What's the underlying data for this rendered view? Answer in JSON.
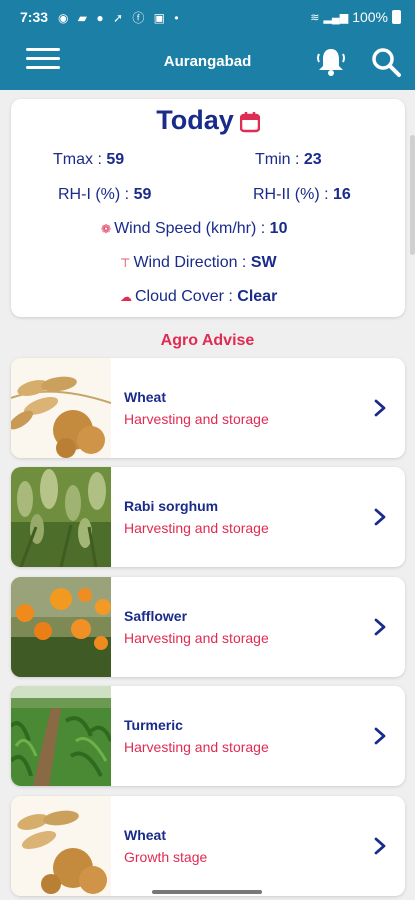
{
  "status_bar": {
    "time": "7:33",
    "battery": "100%"
  },
  "app_bar": {
    "title": "Aurangabad"
  },
  "weather": {
    "title": "Today",
    "tmax_label": "Tmax :",
    "tmax_value": "59",
    "tmin_label": "Tmin :",
    "tmin_value": "23",
    "rh1_label": "RH-I (%) :",
    "rh1_value": "59",
    "rh2_label": "RH-II (%) :",
    "rh2_value": "16",
    "wind_speed_label": "Wind Speed (km/hr) :",
    "wind_speed_value": "10",
    "wind_direction_label": "Wind Direction :",
    "wind_direction_value": "SW",
    "cloud_cover_label": "Cloud Cover :",
    "cloud_cover_value": "Clear"
  },
  "agro_advise": {
    "title": "Agro Advise",
    "items": [
      {
        "name": "Wheat",
        "stage": "Harvesting and storage",
        "image": "wheat-photo"
      },
      {
        "name": "Rabi sorghum",
        "stage": "Harvesting and storage",
        "image": "sorghum-photo"
      },
      {
        "name": "Safflower",
        "stage": "Harvesting and storage",
        "image": "safflower-photo"
      },
      {
        "name": "Turmeric",
        "stage": "Harvesting and storage",
        "image": "turmeric-photo"
      },
      {
        "name": "Wheat",
        "stage": "Growth stage",
        "image": "wheat-photo"
      }
    ]
  },
  "colors": {
    "primary": "#1b7fa6",
    "navy": "#1a2b8a",
    "accent": "#e02b52"
  },
  "icons": [
    "menu-icon",
    "bell-icon",
    "search-icon",
    "calendar-icon",
    "chevron-right-icon"
  ]
}
